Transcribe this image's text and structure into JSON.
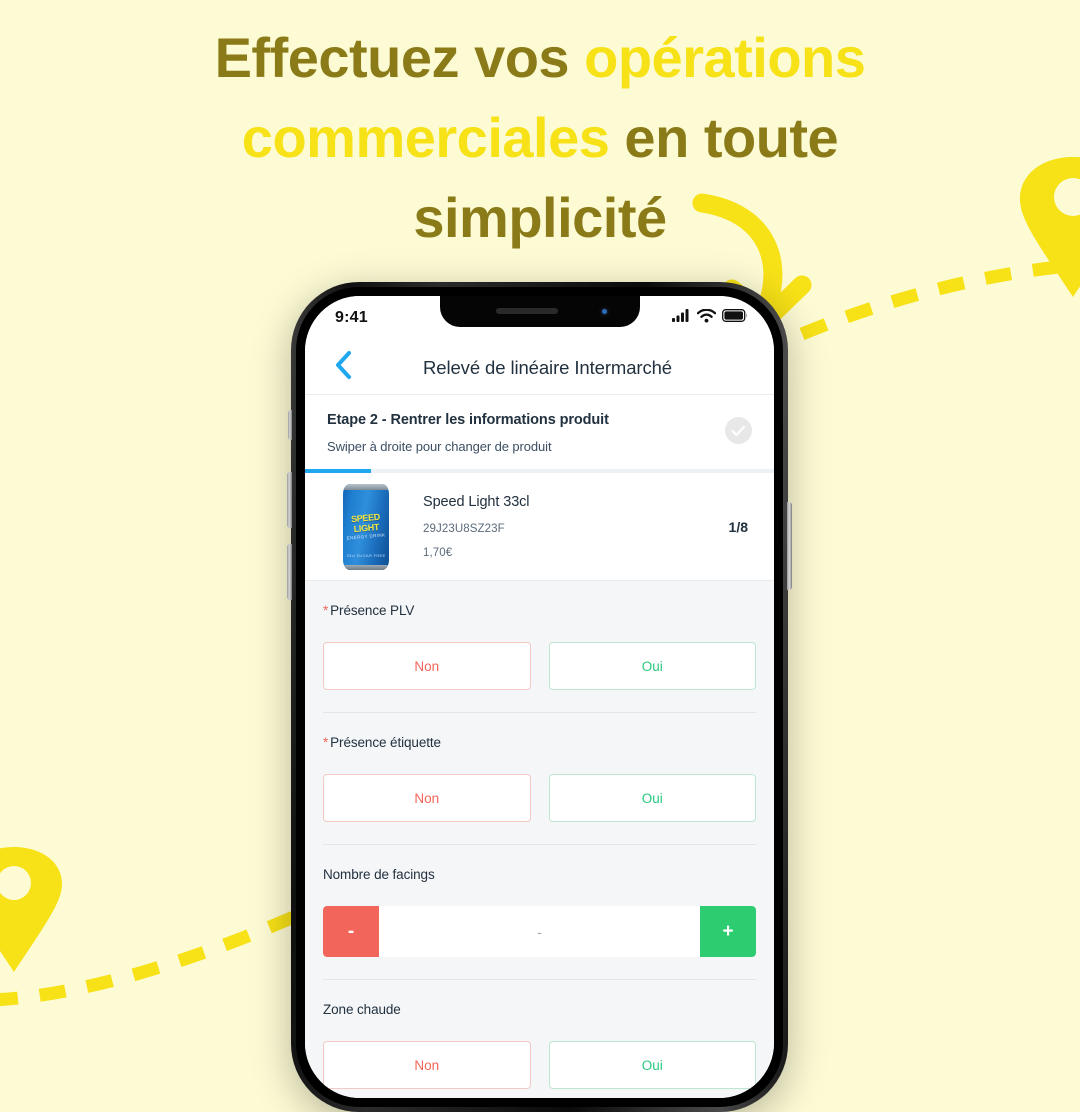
{
  "headline": {
    "line1_a": "Effectuez vos ",
    "line1_b": "opérations",
    "line2_a": "commerciales",
    "line2_b": " en toute",
    "line3": "simplicité",
    "color_dark": "#8a7a18",
    "color_accent": "#f7e117"
  },
  "background_color": "#fdfbd4",
  "decorations": {
    "arrow_down": "curved-arrow-down-icon",
    "dashed_path_right": "dashed-path",
    "dashed_path_left": "dashed-path",
    "pin_right": "map-pin-icon",
    "pin_left": "map-pin-icon",
    "accent_color": "#f7e117"
  },
  "phone": {
    "statusbar": {
      "time": "9:41",
      "signal_icon": "cellular-signal-icon",
      "wifi_icon": "wifi-icon",
      "battery_icon": "battery-full-icon"
    },
    "navbar": {
      "back_icon": "chevron-left-icon",
      "title": "Relevé de linéaire Intermarché",
      "back_color": "#1fa8f0"
    },
    "step": {
      "title": "Etape 2 - Rentrer les informations produit",
      "subtitle": "Swiper à droite pour changer de produit",
      "check_icon": "check-circle-icon",
      "progress_percent": 14,
      "progress_color": "#1fa8f0"
    },
    "product": {
      "image_alt": "speed-light-can",
      "can_brand_line1": "SPEED",
      "can_brand_line2": "LIGHT",
      "can_tagline": "ENERGY DRINK",
      "can_footer": "33cl  SUGAR FREE",
      "name": "Speed Light 33cl",
      "sku": "29J23U8SZ23F",
      "price": "1,70€",
      "counter": "1/8"
    },
    "fields": [
      {
        "label": "Présence PLV",
        "required": true,
        "type": "choice",
        "options": [
          {
            "label": "Non",
            "style": "no"
          },
          {
            "label": "Oui",
            "style": "yes"
          }
        ]
      },
      {
        "label": "Présence étiquette",
        "required": true,
        "type": "choice",
        "options": [
          {
            "label": "Non",
            "style": "no"
          },
          {
            "label": "Oui",
            "style": "yes"
          }
        ]
      },
      {
        "label": "Nombre de facings",
        "required": false,
        "type": "stepper",
        "minus_label": "-",
        "value": "-",
        "plus_label": "+",
        "minus_color": "#f2655a",
        "plus_color": "#2ecc71"
      },
      {
        "label": "Zone chaude",
        "required": false,
        "type": "choice",
        "options": [
          {
            "label": "Non",
            "style": "no"
          },
          {
            "label": "Oui",
            "style": "yes"
          }
        ]
      }
    ],
    "colors": {
      "no_text": "#f2655a",
      "yes_text": "#29c97e",
      "required_star": "#ee6a5e",
      "text_dark": "#22313f",
      "form_bg": "#f4f6f8"
    }
  }
}
